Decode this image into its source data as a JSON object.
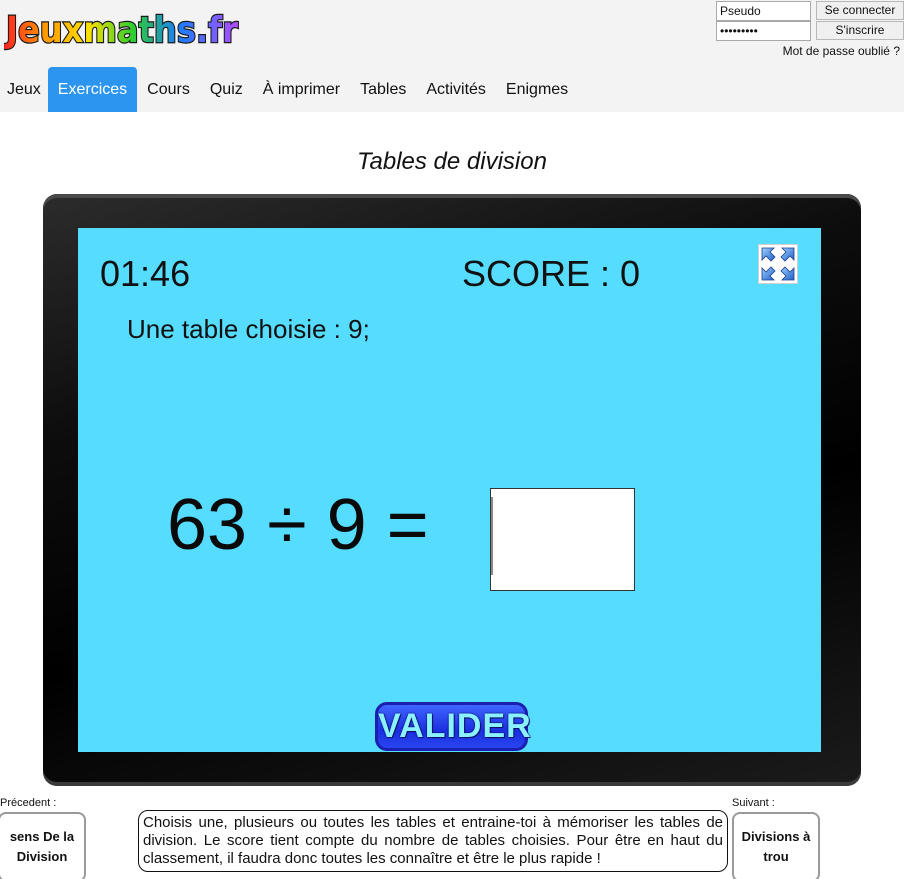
{
  "header": {
    "logo_text": "Jeuxmaths.fr",
    "login": {
      "username_value": "Pseudo",
      "password_value": "•••••••••",
      "connect_label": "Se connecter",
      "register_label": "S'inscrire",
      "forgot_label": "Mot de passe oublié ?"
    },
    "nav": [
      {
        "label": "Jeux"
      },
      {
        "label": "Exercices",
        "active": true
      },
      {
        "label": "Cours"
      },
      {
        "label": "Quiz"
      },
      {
        "label": "À imprimer"
      },
      {
        "label": "Tables"
      },
      {
        "label": "Activités"
      },
      {
        "label": "Enigmes"
      }
    ]
  },
  "title": "Tables de division",
  "game": {
    "timer": "01:46",
    "score": "SCORE : 0",
    "table_info": "Une table choisie : 9;",
    "question": "63 ÷ 9 =",
    "answer_value": "",
    "validate_label": "VALIDER",
    "fullscreen_icon": "fullscreen-icon"
  },
  "footer": {
    "prev_label": "Précedent :",
    "prev_link": "sens De la Division",
    "next_label": "Suivant :",
    "next_link": "Divisions à trou",
    "description": "Choisis une, plusieurs ou toutes les tables et entraine-toi à mémoriser les tables de division. Le score tient compte du nombre de tables choisies. Pour être en haut du classement, il faudra donc toutes les connaître et être le plus rapide !"
  },
  "colors": {
    "nav_active": "#2b95f0",
    "screen_bg": "#55dcff",
    "button_bg": "#1b2fe0"
  }
}
